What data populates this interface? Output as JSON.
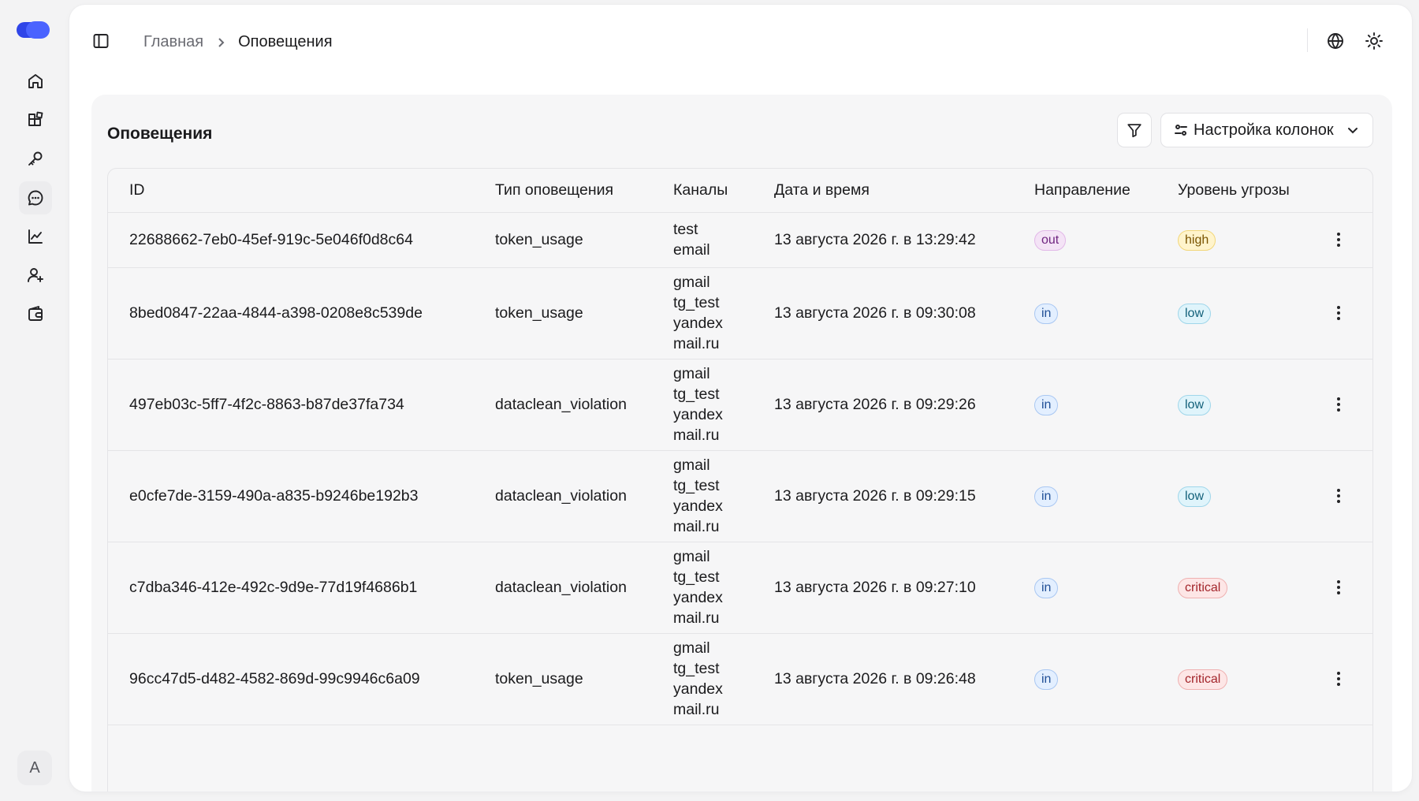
{
  "breadcrumb": {
    "home": "Главная",
    "current": "Оповещения"
  },
  "panel": {
    "title": "Оповещения",
    "columns_button": "Настройка колонок"
  },
  "user": {
    "avatar_initial": "A"
  },
  "colors": {
    "logo": "#3b5bff",
    "out": {
      "bg": "#f4e3f6",
      "border": "#e2b8e8",
      "text": "#6f2480"
    },
    "in": {
      "bg": "#e3efff",
      "border": "#a9c7f2",
      "text": "#1f4e96"
    },
    "high": {
      "bg": "#fff4cc",
      "border": "#f2d77a",
      "text": "#7a5400"
    },
    "low": {
      "bg": "#dff4fb",
      "border": "#9fd6ea",
      "text": "#13617a"
    },
    "critical": {
      "bg": "#fde6e6",
      "border": "#efb1b1",
      "text": "#a3252b"
    }
  },
  "table": {
    "headers": [
      "ID",
      "Тип оповещения",
      "Каналы",
      "Дата и время",
      "Направление",
      "Уровень угрозы"
    ],
    "rows": [
      {
        "id": "22688662-7eb0-45ef-919c-5e046f0d8c64",
        "type": "token_usage",
        "channels": [
          "test",
          "email"
        ],
        "datetime": "13 августа 2026 г. в 13:29:42",
        "direction": "out",
        "threat": "high"
      },
      {
        "id": "8bed0847-22aa-4844-a398-0208e8c539de",
        "type": "token_usage",
        "channels": [
          "gmail",
          "tg_test",
          "yandex",
          "mail.ru"
        ],
        "datetime": "13 августа 2026 г. в 09:30:08",
        "direction": "in",
        "threat": "low"
      },
      {
        "id": "497eb03c-5ff7-4f2c-8863-b87de37fa734",
        "type": "dataclean_violation",
        "channels": [
          "gmail",
          "tg_test",
          "yandex",
          "mail.ru"
        ],
        "datetime": "13 августа 2026 г. в 09:29:26",
        "direction": "in",
        "threat": "low"
      },
      {
        "id": "e0cfe7de-3159-490a-a835-b9246be192b3",
        "type": "dataclean_violation",
        "channels": [
          "gmail",
          "tg_test",
          "yandex",
          "mail.ru"
        ],
        "datetime": "13 августа 2026 г. в 09:29:15",
        "direction": "in",
        "threat": "low"
      },
      {
        "id": "c7dba346-412e-492c-9d9e-77d19f4686b1",
        "type": "dataclean_violation",
        "channels": [
          "gmail",
          "tg_test",
          "yandex",
          "mail.ru"
        ],
        "datetime": "13 августа 2026 г. в 09:27:10",
        "direction": "in",
        "threat": "critical"
      },
      {
        "id": "96cc47d5-d482-4582-869d-99c9946c6a09",
        "type": "token_usage",
        "channels": [
          "gmail",
          "tg_test",
          "yandex",
          "mail.ru"
        ],
        "datetime": "13 августа 2026 г. в 09:26:48",
        "direction": "in",
        "threat": "critical"
      }
    ]
  },
  "icons": {
    "nav": [
      "home-icon",
      "blocks-icon",
      "key-icon",
      "message-icon",
      "chart-line-icon",
      "user-plus-icon",
      "wallet-icon"
    ],
    "active_nav": "message-icon",
    "top": [
      "sidebar-toggle-icon",
      "globe-icon",
      "sun-icon"
    ],
    "toolbar": [
      "filter-icon",
      "sliders-icon",
      "chevron-down-icon"
    ],
    "row_action": "more-vertical-icon"
  }
}
